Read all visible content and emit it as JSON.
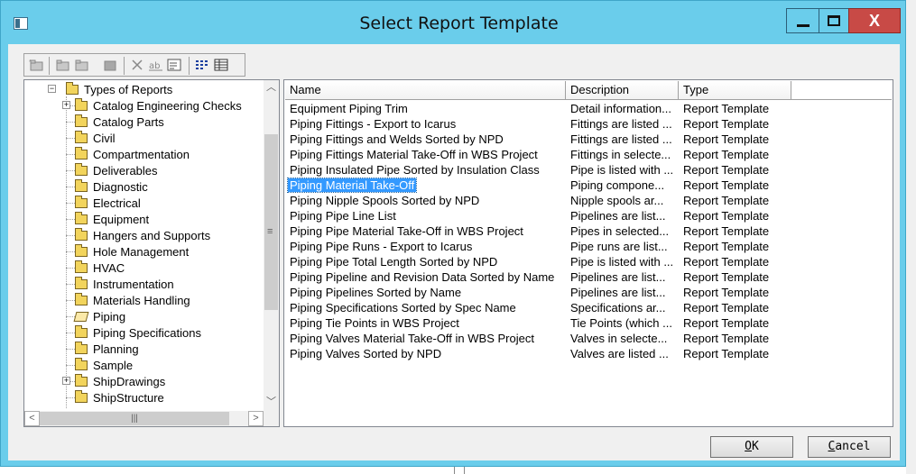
{
  "window": {
    "title": "Select Report Template",
    "close_glyph": "X"
  },
  "tree": {
    "root_label": "Types of Reports",
    "items": [
      {
        "label": "Catalog Engineering Checks",
        "expandable": true,
        "open": false
      },
      {
        "label": "Catalog Parts",
        "expandable": false,
        "open": false
      },
      {
        "label": "Civil",
        "expandable": false,
        "open": false
      },
      {
        "label": "Compartmentation",
        "expandable": false,
        "open": false
      },
      {
        "label": "Deliverables",
        "expandable": false,
        "open": false
      },
      {
        "label": "Diagnostic",
        "expandable": false,
        "open": false
      },
      {
        "label": "Electrical",
        "expandable": false,
        "open": false
      },
      {
        "label": "Equipment",
        "expandable": false,
        "open": false
      },
      {
        "label": "Hangers and Supports",
        "expandable": false,
        "open": false
      },
      {
        "label": "Hole Management",
        "expandable": false,
        "open": false
      },
      {
        "label": "HVAC",
        "expandable": false,
        "open": false
      },
      {
        "label": "Instrumentation",
        "expandable": false,
        "open": false
      },
      {
        "label": "Materials Handling",
        "expandable": false,
        "open": false
      },
      {
        "label": "Piping",
        "expandable": false,
        "open": true
      },
      {
        "label": "Piping Specifications",
        "expandable": false,
        "open": false
      },
      {
        "label": "Planning",
        "expandable": false,
        "open": false
      },
      {
        "label": "Sample",
        "expandable": false,
        "open": false
      },
      {
        "label": "ShipDrawings",
        "expandable": true,
        "open": false
      },
      {
        "label": "ShipStructure",
        "expandable": false,
        "open": false
      }
    ]
  },
  "list": {
    "columns": [
      "Name",
      "Description",
      "Type"
    ],
    "selected_index": 5,
    "rows": [
      {
        "name": "Equipment Piping Trim",
        "description": "Detail information...",
        "type": "Report Template"
      },
      {
        "name": "Piping Fittings - Export to Icarus",
        "description": "Fittings are listed ...",
        "type": "Report Template"
      },
      {
        "name": "Piping Fittings and Welds Sorted by NPD",
        "description": "Fittings are listed ...",
        "type": "Report Template"
      },
      {
        "name": "Piping Fittings Material Take-Off in WBS Project",
        "description": "Fittings in selecte...",
        "type": "Report Template"
      },
      {
        "name": "Piping Insulated Pipe Sorted by Insulation Class",
        "description": "Pipe is listed with ...",
        "type": "Report Template"
      },
      {
        "name": "Piping Material Take-Off",
        "description": "Piping compone...",
        "type": "Report Template"
      },
      {
        "name": "Piping Nipple Spools Sorted by NPD",
        "description": "Nipple spools ar...",
        "type": "Report Template"
      },
      {
        "name": "Piping Pipe Line List",
        "description": "Pipelines are list...",
        "type": "Report Template"
      },
      {
        "name": "Piping Pipe Material Take-Off in WBS Project",
        "description": "Pipes in selected...",
        "type": "Report Template"
      },
      {
        "name": "Piping Pipe Runs - Export to Icarus",
        "description": "Pipe runs are list...",
        "type": "Report Template"
      },
      {
        "name": "Piping Pipe Total Length Sorted by NPD",
        "description": "Pipe is listed with ...",
        "type": "Report Template"
      },
      {
        "name": "Piping Pipeline and Revision Data Sorted by Name",
        "description": "Pipelines are list...",
        "type": "Report Template"
      },
      {
        "name": "Piping Pipelines Sorted by Name",
        "description": "Pipelines are list...",
        "type": "Report Template"
      },
      {
        "name": "Piping Specifications Sorted by Spec Name",
        "description": "Specifications ar...",
        "type": "Report Template"
      },
      {
        "name": "Piping Tie Points in WBS Project",
        "description": "Tie Points (which ...",
        "type": "Report Template"
      },
      {
        "name": "Piping Valves Material Take-Off in WBS Project",
        "description": "Valves in selecte...",
        "type": "Report Template"
      },
      {
        "name": "Piping Valves Sorted by NPD",
        "description": "Valves are listed ...",
        "type": "Report Template"
      }
    ]
  },
  "buttons": {
    "ok": {
      "mnemonic": "O",
      "rest": "K"
    },
    "cancel": {
      "mnemonic": "C",
      "rest": "ancel"
    }
  },
  "icons": {
    "toolbar": [
      "new-folder-icon",
      "new-item-icon",
      "copy-folder-icon",
      "paste-icon",
      "delete-icon",
      "rename-icon",
      "properties-icon",
      "list-view-icon",
      "details-view-icon"
    ]
  }
}
